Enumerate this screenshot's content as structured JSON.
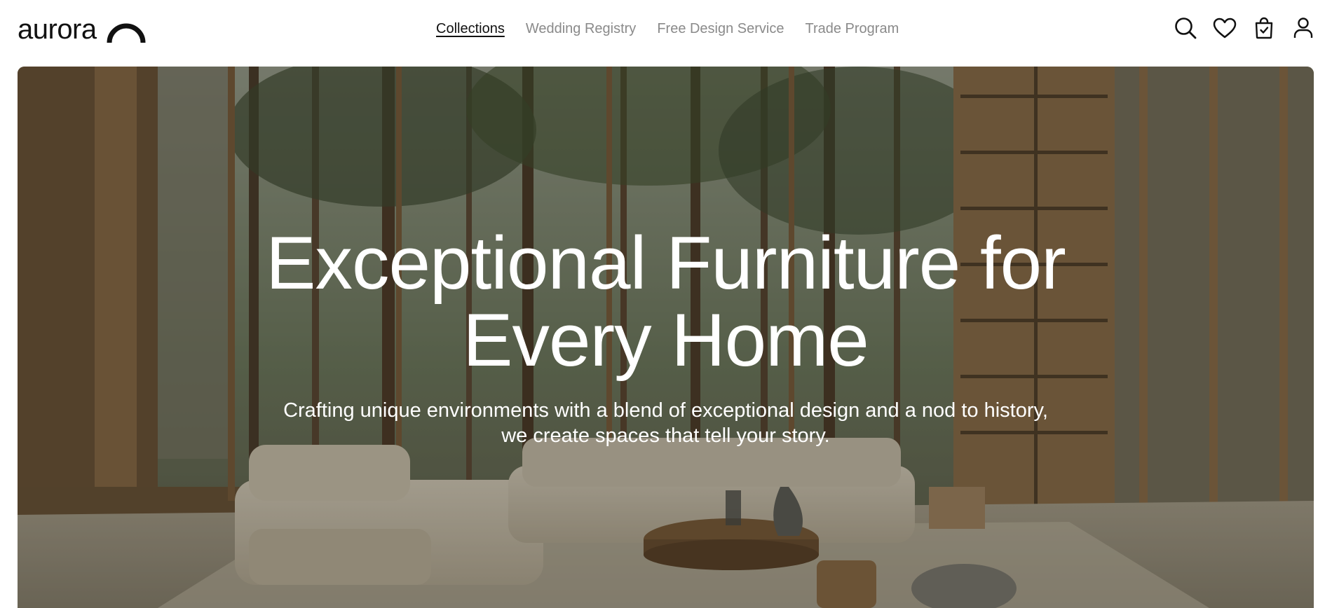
{
  "brand": {
    "name": "aurora"
  },
  "nav": {
    "items": [
      {
        "label": "Collections",
        "active": true
      },
      {
        "label": "Wedding Registry",
        "active": false
      },
      {
        "label": "Free Design Service",
        "active": false
      },
      {
        "label": "Trade Program",
        "active": false
      }
    ]
  },
  "header_icons": [
    "search-icon",
    "heart-icon",
    "shopping-bag-icon",
    "user-icon"
  ],
  "hero": {
    "title_line1": "Exceptional Furniture for",
    "title_line2": "Every Home",
    "subtitle_line1": "Crafting unique environments with a blend of exceptional design and a nod to history,",
    "subtitle_line2": "we create spaces that tell your story."
  },
  "colors": {
    "text_primary": "#111111",
    "nav_inactive": "#8a8a8a",
    "hero_text": "#ffffff"
  }
}
